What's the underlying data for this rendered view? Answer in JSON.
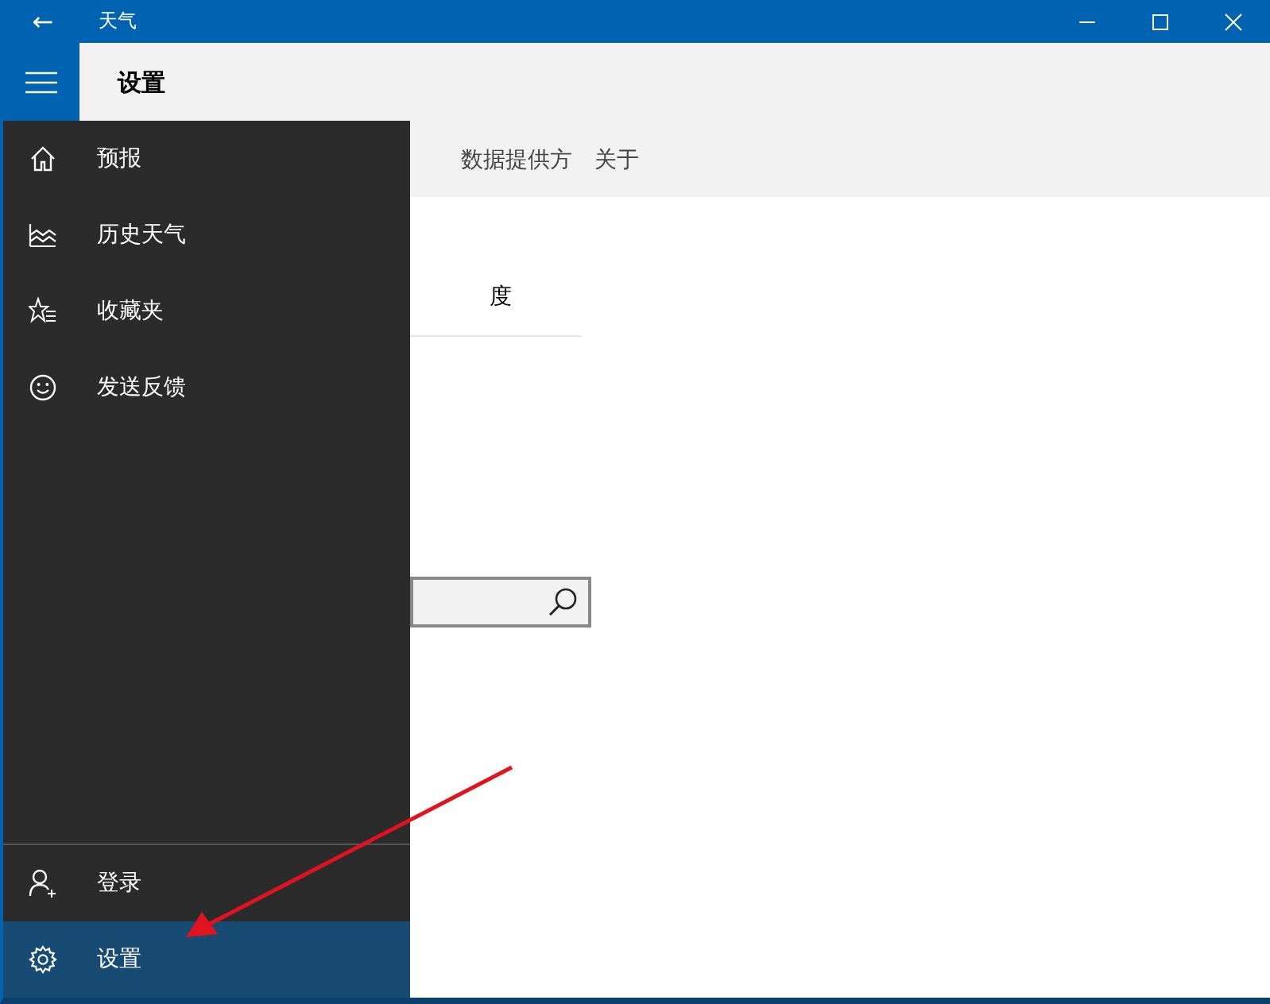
{
  "window": {
    "title": "天气",
    "back": "←"
  },
  "page": {
    "title": "设置"
  },
  "tabs": [
    {
      "label": "数据提供方",
      "selected": false
    },
    {
      "label": "关于",
      "selected": false
    }
  ],
  "content": {
    "unit_fragment": "度"
  },
  "nav": {
    "items": [
      {
        "label": "预报",
        "selected": false
      },
      {
        "label": "历史天气",
        "selected": false
      },
      {
        "label": "收藏夹",
        "selected": false
      },
      {
        "label": "发送反馈",
        "selected": false
      }
    ],
    "bottom_items": [
      {
        "label": "登录",
        "selected": false
      },
      {
        "label": "设置",
        "selected": true
      }
    ]
  }
}
